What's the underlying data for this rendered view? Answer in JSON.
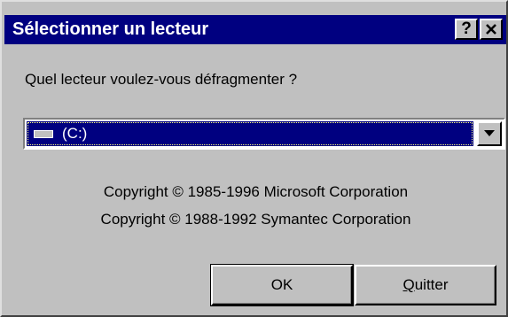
{
  "dialog": {
    "title": "Sélectionner un lecteur",
    "help_label": "?",
    "close_label": "✕"
  },
  "prompt": "Quel lecteur voulez-vous défragmenter ?",
  "drive_select": {
    "selected": "(C:)",
    "drive_icon": "hard-drive-icon",
    "arrow_icon": "chevron-down-icon"
  },
  "copyright": [
    "Copyright © 1985-1996 Microsoft Corporation",
    "Copyright © 1988-1992 Symantec Corporation"
  ],
  "buttons": {
    "ok": "OK",
    "quit_accel": "Q",
    "quit_rest": "uitter"
  },
  "colors": {
    "title_bar": "#000080",
    "face": "#c0c0c0",
    "selection": "#000080"
  }
}
